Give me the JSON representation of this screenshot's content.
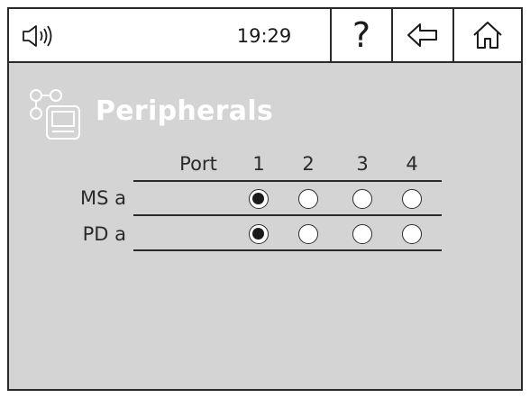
{
  "header": {
    "volume_icon": "speaker-icon",
    "time": "19:29",
    "help_label": "?",
    "back_icon": "arrow-left-icon",
    "home_icon": "home-icon"
  },
  "page": {
    "title": "Peripherals",
    "icon": "peripherals-icon"
  },
  "table": {
    "port_header": "Port",
    "ports": [
      "1",
      "2",
      "3",
      "4"
    ],
    "rows": [
      {
        "label": "MS a",
        "selected_port": "1"
      },
      {
        "label": "PD a",
        "selected_port": "1"
      }
    ]
  }
}
